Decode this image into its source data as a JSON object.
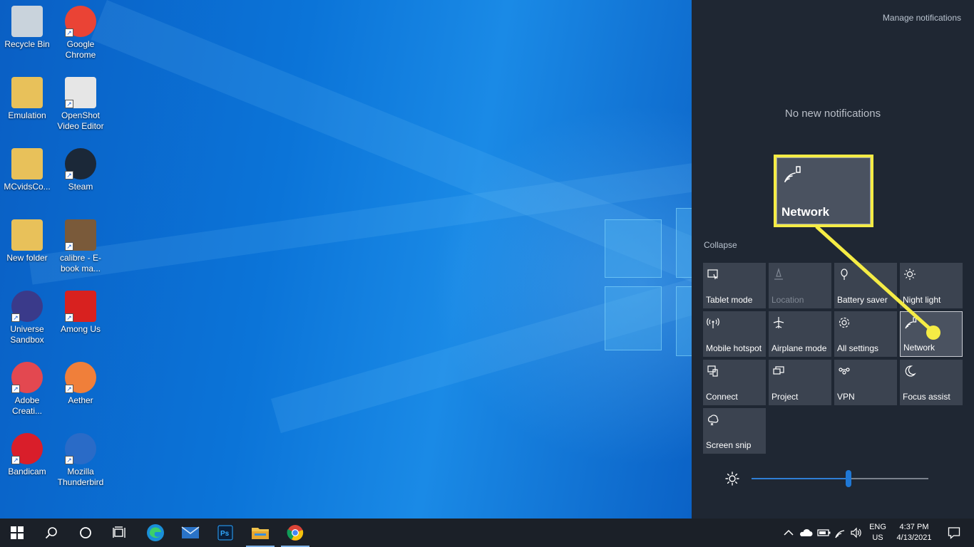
{
  "desktop": {
    "icons": [
      {
        "label": "Recycle Bin",
        "icon": "recycle-bin-icon",
        "color": "#c9d3dc"
      },
      {
        "label": "Google Chrome",
        "icon": "chrome-icon",
        "color": "#ea4335"
      },
      {
        "label": "Emulation",
        "icon": "folder-icon",
        "color": "#e8c15a"
      },
      {
        "label": "OpenShot Video Editor",
        "icon": "openshot-icon",
        "color": "#e6e6e6"
      },
      {
        "label": "MCvidsCo...",
        "icon": "folder-icon",
        "color": "#e8c15a"
      },
      {
        "label": "Steam",
        "icon": "steam-icon",
        "color": "#1b2838"
      },
      {
        "label": "New folder",
        "icon": "folder-icon",
        "color": "#e8c15a"
      },
      {
        "label": "calibre - E-book ma...",
        "icon": "calibre-icon",
        "color": "#7a5a3a"
      },
      {
        "label": "Universe Sandbox",
        "icon": "universe-sandbox-icon",
        "color": "#3a3a8a"
      },
      {
        "label": "Among Us",
        "icon": "among-us-icon",
        "color": "#d8211f"
      },
      {
        "label": "Adobe Creati...",
        "icon": "adobe-creative-cloud-icon",
        "color": "#e34850"
      },
      {
        "label": "Aether",
        "icon": "aether-icon",
        "color": "#f07f3a"
      },
      {
        "label": "Bandicam",
        "icon": "bandicam-icon",
        "color": "#d91e2a"
      },
      {
        "label": "Mozilla Thunderbird",
        "icon": "thunderbird-icon",
        "color": "#2a6bc7"
      }
    ]
  },
  "action_center": {
    "manage_notifications": "Manage notifications",
    "no_notifications": "No new notifications",
    "collapse": "Collapse",
    "tiles": [
      {
        "label": "Tablet mode",
        "icon": "tablet-mode-icon",
        "disabled": false
      },
      {
        "label": "Location",
        "icon": "location-icon",
        "disabled": true
      },
      {
        "label": "Battery saver",
        "icon": "battery-saver-icon",
        "disabled": false
      },
      {
        "label": "Night light",
        "icon": "night-light-icon",
        "disabled": false
      },
      {
        "label": "Mobile hotspot",
        "icon": "mobile-hotspot-icon",
        "disabled": false
      },
      {
        "label": "Airplane mode",
        "icon": "airplane-mode-icon",
        "disabled": false
      },
      {
        "label": "All settings",
        "icon": "gear-icon",
        "disabled": false
      },
      {
        "label": "Network",
        "icon": "network-icon",
        "disabled": false
      },
      {
        "label": "Connect",
        "icon": "connect-icon",
        "disabled": false
      },
      {
        "label": "Project",
        "icon": "project-icon",
        "disabled": false
      },
      {
        "label": "VPN",
        "icon": "vpn-icon",
        "disabled": false
      },
      {
        "label": "Focus assist",
        "icon": "focus-assist-icon",
        "disabled": false
      },
      {
        "label": "Screen snip",
        "icon": "screen-snip-icon",
        "disabled": false
      }
    ],
    "brightness": {
      "value": 0.55,
      "accent": "#1f78d6"
    }
  },
  "callout": {
    "label": "Network",
    "color": "#f5ec45"
  },
  "taskbar": {
    "language": {
      "line1": "ENG",
      "line2": "US"
    },
    "clock": {
      "time": "4:37 PM",
      "date": "4/13/2021"
    }
  }
}
